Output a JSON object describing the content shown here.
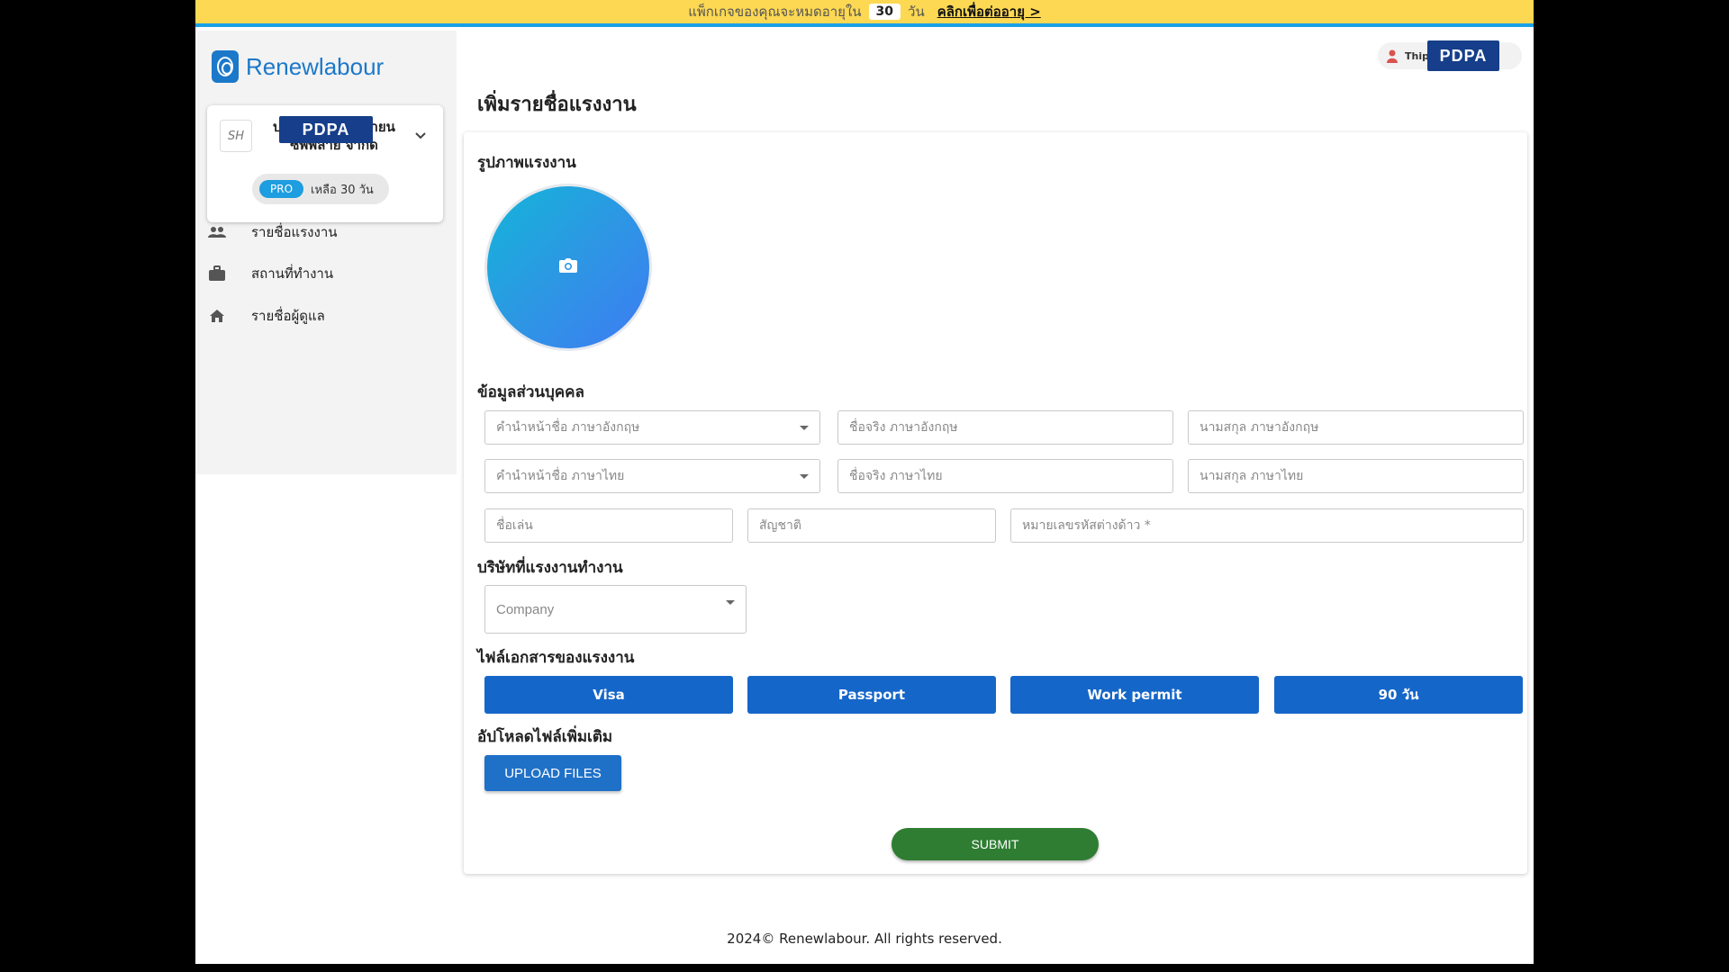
{
  "banner": {
    "text": "แพ็กเกจของคุณจะหมดอายุใน",
    "days": "30",
    "unit": "วัน",
    "link": "คลิกเพื่อต่ออายุ >"
  },
  "sidebar": {
    "logo_text": "Renewlabour",
    "company": {
      "avatar": "SH",
      "name_line1": "บริษัท ทีเอส อัลลายน",
      "name_line2": "ซัพพลาย จำกัด",
      "plan": "PRO",
      "remaining": "เหลือ 30 วัน",
      "badge": "PDPA"
    },
    "items": [
      {
        "label": "รายชื่อแรงงาน",
        "icon": "people-icon"
      },
      {
        "label": "สถานที่ทำงาน",
        "icon": "briefcase-icon"
      },
      {
        "label": "รายชื่อผู้ดูแล",
        "icon": "home-icon"
      }
    ]
  },
  "header": {
    "user_name": "Thip... Tangpho",
    "user_badge": "PDPA"
  },
  "page_title": "เพิ่มรายชื่อแรงงาน",
  "form": {
    "photo_label": "รูปภาพแรงงาน",
    "personal_label": "ข้อมูลส่วนบุคคล",
    "fields": {
      "prefix_en": "คำนำหน้าชื่อ ภาษาอังกฤษ",
      "firstname_en": "ชื่อจริง ภาษาอังกฤษ",
      "lastname_en": "นามสกุล ภาษาอังกฤษ",
      "prefix_th": "คำนำหน้าชื่อ ภาษาไทย",
      "firstname_th": "ชื่อจริง ภาษาไทย",
      "lastname_th": "นามสกุล ภาษาไทย",
      "nickname": "ชื่อเล่น",
      "nationality": "สัญชาติ",
      "alien_id": "หมายเลขรหัสต่างด้าว *"
    },
    "company_label": "บริษัทที่แรงงานทำงาน",
    "company_placeholder": "Company",
    "docs_label": "ไฟล์เอกสารของแรงงาน",
    "docs": [
      "Visa",
      "Passport",
      "Work permit",
      "90 วัน"
    ],
    "upload_label": "อัปโหลดไฟล์เพิ่มเติม",
    "upload_button": "UPLOAD FILES",
    "submit_button": "SUBMIT"
  },
  "footer": "2024© Renewlabour. All rights reserved.",
  "colors": {
    "banner": "#fdd853",
    "primary": "#1566c9",
    "submit": "#2e7d32",
    "pro": "#1e9de0"
  }
}
